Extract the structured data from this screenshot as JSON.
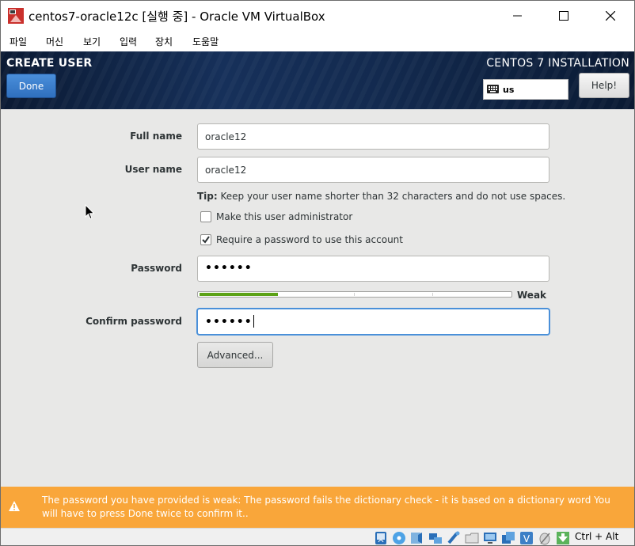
{
  "window": {
    "title": "centos7-oracle12c [실행 중] - Oracle VM VirtualBox",
    "menu": [
      "파일",
      "머신",
      "보기",
      "입력",
      "장치",
      "도움말"
    ]
  },
  "header": {
    "title": "CREATE USER",
    "done_label": "Done",
    "install_title": "CENTOS 7 INSTALLATION",
    "keyboard_layout": "us",
    "help_label": "Help!"
  },
  "form": {
    "full_name_label": "Full name",
    "full_name_value": "oracle12",
    "user_name_label": "User name",
    "user_name_value": "oracle12",
    "tip_prefix": "Tip:",
    "tip_text": " Keep your user name shorter than 32 characters and do not use spaces.",
    "admin_label": "Make this user administrator",
    "admin_checked": false,
    "require_pw_label": "Require a password to use this account",
    "require_pw_checked": true,
    "password_label": "Password",
    "password_value": "••••••",
    "strength_label": "Weak",
    "strength_fraction": 0.25,
    "confirm_label": "Confirm password",
    "confirm_value": "••••••",
    "advanced_label": "Advanced..."
  },
  "warning": {
    "text": "The password you have provided is weak: The password fails the dictionary check - it is based on a dictionary word You will have to press Done twice to confirm it.."
  },
  "statusbar": {
    "host_key": "Ctrl + Alt",
    "icons": [
      "hard-disk-icon",
      "optical-disc-icon",
      "audio-icon",
      "network-icon",
      "usb-icon",
      "shared-folders-icon",
      "display-icon",
      "recording-icon",
      "virtualization-icon",
      "mouse-integration-icon",
      "host-key-icon"
    ]
  },
  "colors": {
    "header_bg": "#132a4f",
    "done_button": "#3b7fcf",
    "warning_bg": "#f9a63a",
    "strength_fill": "#5ba215",
    "focus_border": "#4a90d9"
  }
}
